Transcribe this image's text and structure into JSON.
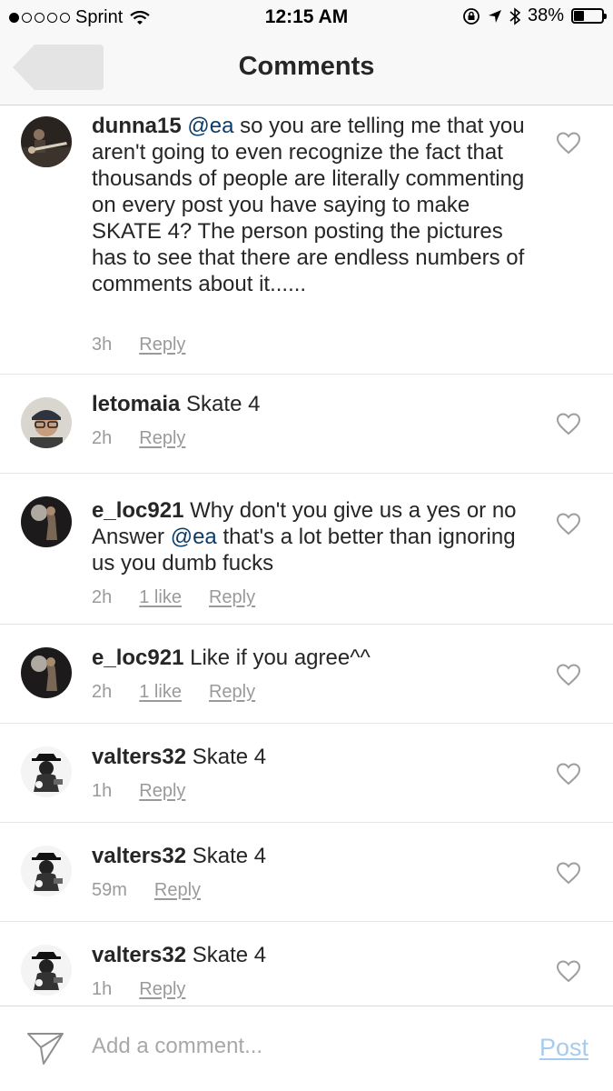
{
  "status_bar": {
    "carrier": "Sprint",
    "time": "12:15 AM",
    "battery": "38%",
    "battery_level": 0.38
  },
  "nav": {
    "title": "Comments"
  },
  "comments": [
    {
      "username": "dunna15",
      "mention": "@ea",
      "text": "so you are telling me that you aren't going to even recognize the fact that thousands of people are literally commenting on every post you have saying to make SKATE 4? The person posting the pictures has to see that there are endless numbers of comments about it......",
      "time": "3h",
      "likes": "",
      "reply": "Reply"
    },
    {
      "username": "letomaia",
      "text": "Skate 4",
      "time": "2h",
      "likes": "",
      "reply": "Reply"
    },
    {
      "username": "e_loc921",
      "text_before": "Why don't you give us a yes or no Answer",
      "mention": "@ea",
      "text_after": "that's a lot better than ignoring us you dumb fucks",
      "time": "2h",
      "likes": "1 like",
      "reply": "Reply"
    },
    {
      "username": "e_loc921",
      "text": "Like if you agree^^",
      "time": "2h",
      "likes": "1 like",
      "reply": "Reply"
    },
    {
      "username": "valters32",
      "text": "Skate 4",
      "time": "1h",
      "likes": "",
      "reply": "Reply"
    },
    {
      "username": "valters32",
      "text": "Skate 4",
      "time": "59m",
      "likes": "",
      "reply": "Reply"
    },
    {
      "username": "valters32",
      "text": "Skate 4",
      "time": "1h",
      "likes": "",
      "reply": "Reply"
    }
  ],
  "input": {
    "placeholder": "Add a comment...",
    "post_label": "Post"
  },
  "icons": {
    "heart": "heart-outline-icon",
    "send": "paper-plane-icon",
    "back": "back-arrow-icon"
  },
  "colors": {
    "mention": "#0b3d6b",
    "post_disabled": "#a6cbef",
    "meta": "#9a9a9a"
  }
}
